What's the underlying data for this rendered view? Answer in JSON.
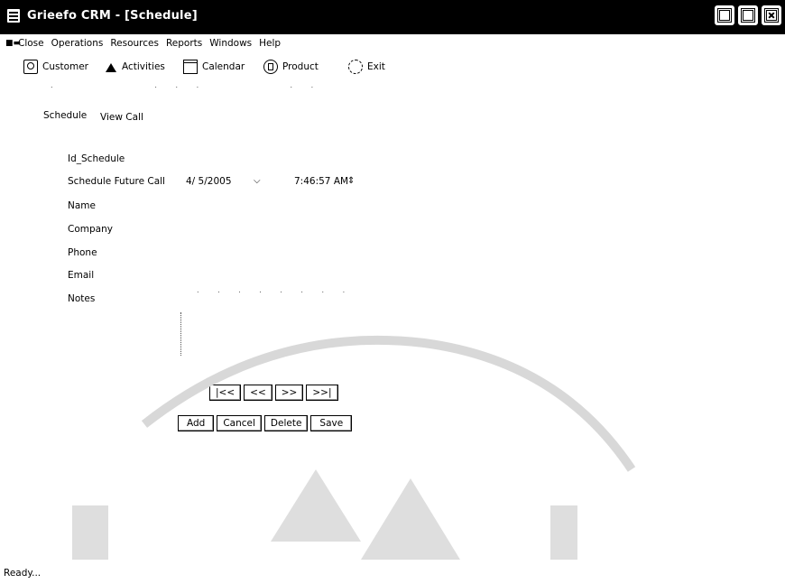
{
  "window": {
    "title": "Grieefo CRM - [Schedule]"
  },
  "menu": {
    "items": [
      "Close",
      "Operations",
      "Resources",
      "Reports",
      "Windows",
      "Help"
    ]
  },
  "toolbar": {
    "items": [
      {
        "label": "Customer",
        "icon": "customer-icon"
      },
      {
        "label": "Activities",
        "icon": "activities-icon"
      },
      {
        "label": "Calendar",
        "icon": "calendar-icon"
      },
      {
        "label": "Product",
        "icon": "product-icon"
      },
      {
        "label": "Exit",
        "icon": "exit-icon"
      }
    ]
  },
  "tabs": [
    "Schedule",
    "View Call"
  ],
  "form": {
    "labels": {
      "id_schedule": "Id_Schedule",
      "schedule_future_call": "Schedule Future Call",
      "name": "Name",
      "company": "Company",
      "phone": "Phone",
      "email": "Email",
      "notes": "Notes"
    },
    "date_value": "4/ 5/2005",
    "time_value": "7:46:57 AM"
  },
  "navigation": {
    "first": "|<<",
    "prev": "<<",
    "next": ">>",
    "last": ">>|"
  },
  "actions": {
    "add": "Add",
    "cancel": "Cancel",
    "delete": "Delete",
    "save": "Save"
  },
  "status": {
    "text": "Ready..."
  }
}
